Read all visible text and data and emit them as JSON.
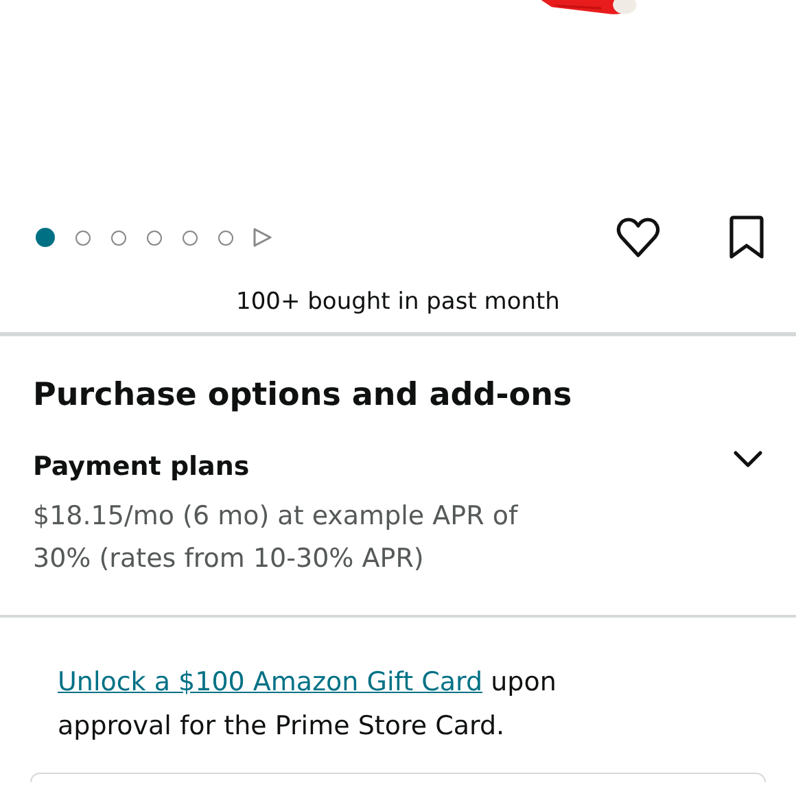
{
  "carousel": {
    "dots": [
      {
        "selected": true
      },
      {
        "selected": false
      },
      {
        "selected": false
      },
      {
        "selected": false
      },
      {
        "selected": false
      },
      {
        "selected": false
      }
    ]
  },
  "social_proof": "100+ bought in past month",
  "purchase_options": {
    "title": "Purchase options and add-ons",
    "payment_plans": {
      "title": "Payment plans",
      "expanded": false,
      "description": "$18.15/mo (6 mo) at example APR of 30% (rates from 10-30% APR)"
    }
  },
  "promo": {
    "link": "Unlock a $100 Amazon Gift Card",
    "text": "upon approval for the Prime Store Card."
  }
}
